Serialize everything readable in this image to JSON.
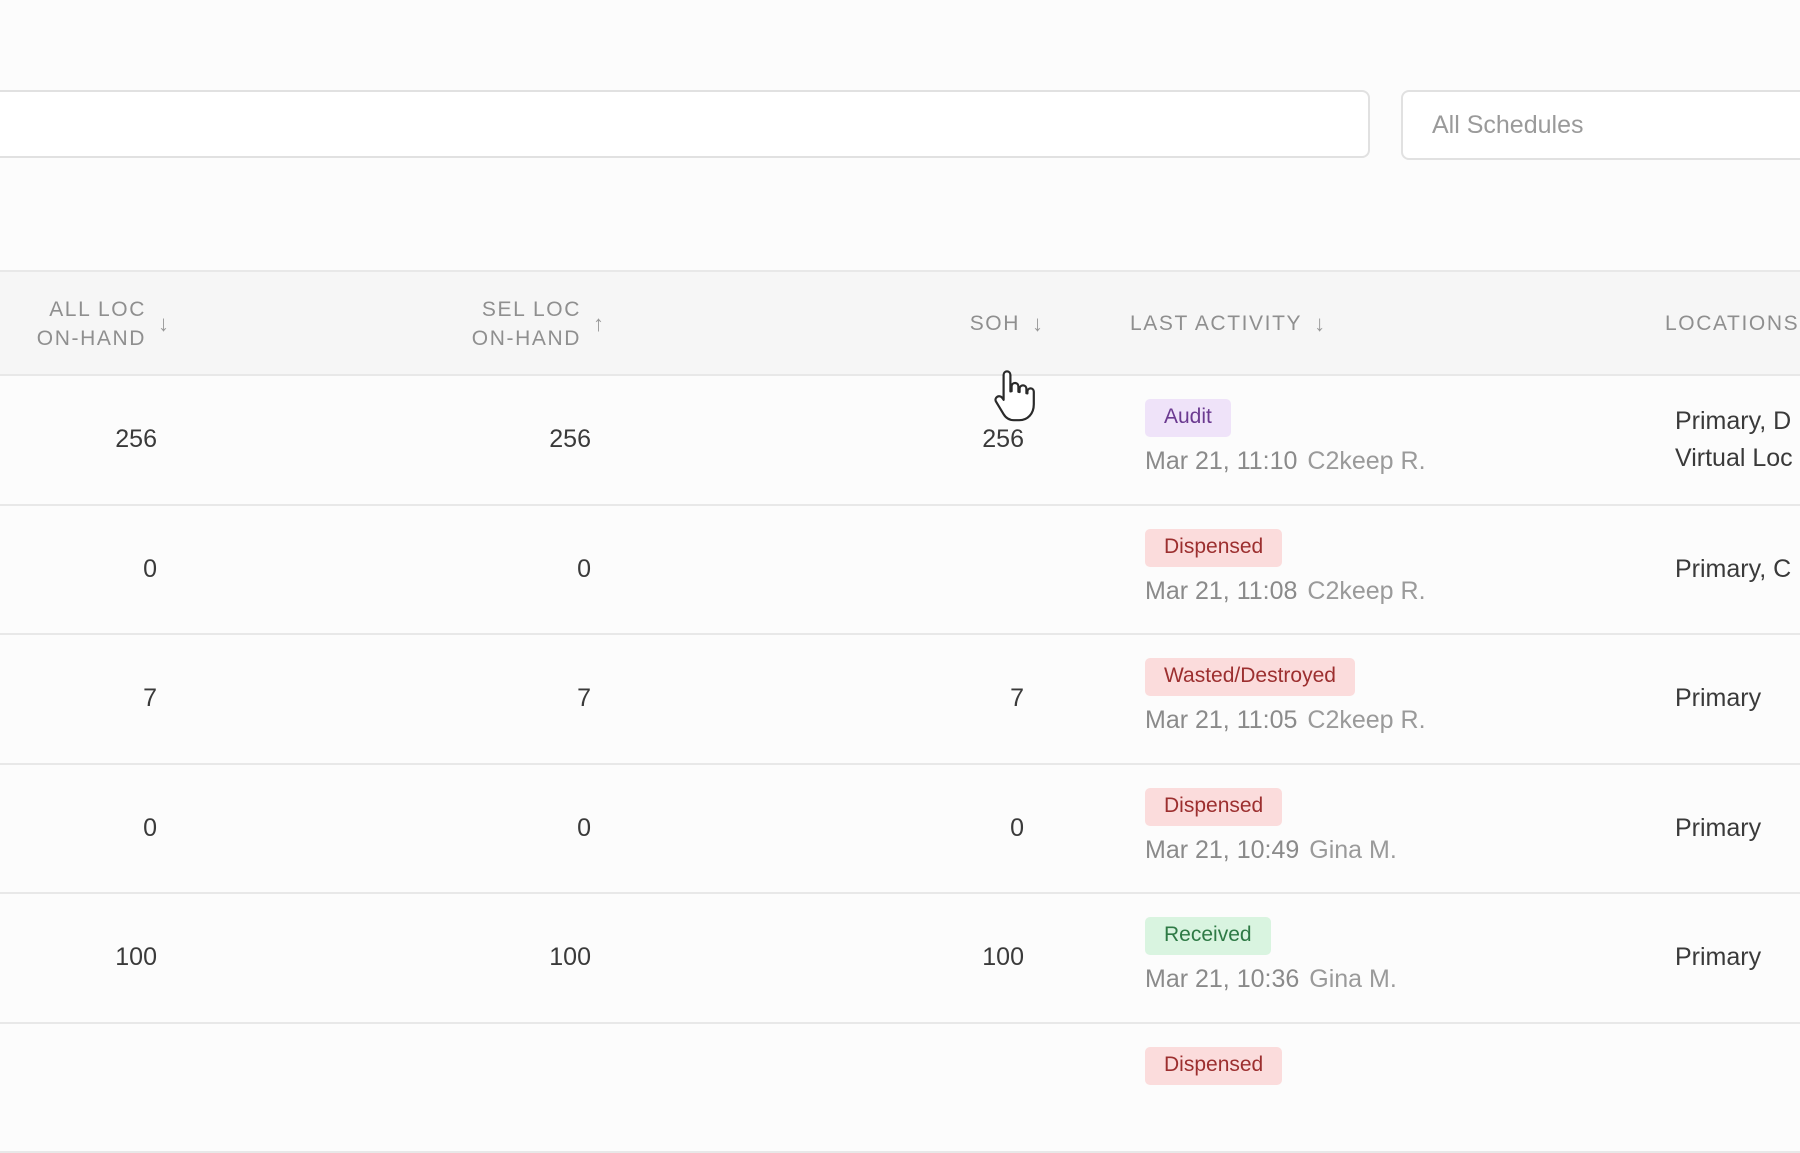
{
  "filters": {
    "search_value": "",
    "schedule_select": "All Schedules"
  },
  "table": {
    "headers": {
      "all_loc_line1": "ALL LOC",
      "all_loc_line2": "ON-HAND",
      "all_loc_sort": "↓",
      "sel_loc_line1": "SEL LOC",
      "sel_loc_line2": "ON-HAND",
      "sel_loc_sort": "↑",
      "soh": "SOH",
      "soh_sort": "↓",
      "last_activity": "LAST ACTIVITY",
      "last_activity_sort": "↓",
      "locations": "LOCATIONS"
    },
    "rows": [
      {
        "all_loc": "256",
        "sel_loc": "256",
        "soh": "256",
        "badge": "Audit",
        "badge_type": "audit",
        "date": "Mar 21, 11:10",
        "user": "C2keep R.",
        "loc1": "Primary, D",
        "loc2": "Virtual Loc"
      },
      {
        "all_loc": "0",
        "sel_loc": "0",
        "soh": "",
        "badge": "Dispensed",
        "badge_type": "dispensed",
        "date": "Mar 21, 11:08",
        "user": "C2keep R.",
        "loc1": "Primary, C",
        "loc2": ""
      },
      {
        "all_loc": "7",
        "sel_loc": "7",
        "soh": "7",
        "badge": "Wasted/Destroyed",
        "badge_type": "wasted",
        "date": "Mar 21, 11:05",
        "user": "C2keep R.",
        "loc1": "Primary",
        "loc2": ""
      },
      {
        "all_loc": "0",
        "sel_loc": "0",
        "soh": "0",
        "badge": "Dispensed",
        "badge_type": "dispensed",
        "date": "Mar 21, 10:49",
        "user": "Gina M.",
        "loc1": "Primary",
        "loc2": ""
      },
      {
        "all_loc": "100",
        "sel_loc": "100",
        "soh": "100",
        "badge": "Received",
        "badge_type": "received",
        "date": "Mar 21, 10:36",
        "user": "Gina M.",
        "loc1": "Primary",
        "loc2": ""
      },
      {
        "all_loc": "",
        "sel_loc": "",
        "soh": "",
        "badge": "Dispensed",
        "badge_type": "dispensed",
        "date": "",
        "user": "",
        "loc1": "",
        "loc2": ""
      }
    ]
  },
  "icons": {
    "cursor": "hand-pointer-icon"
  }
}
